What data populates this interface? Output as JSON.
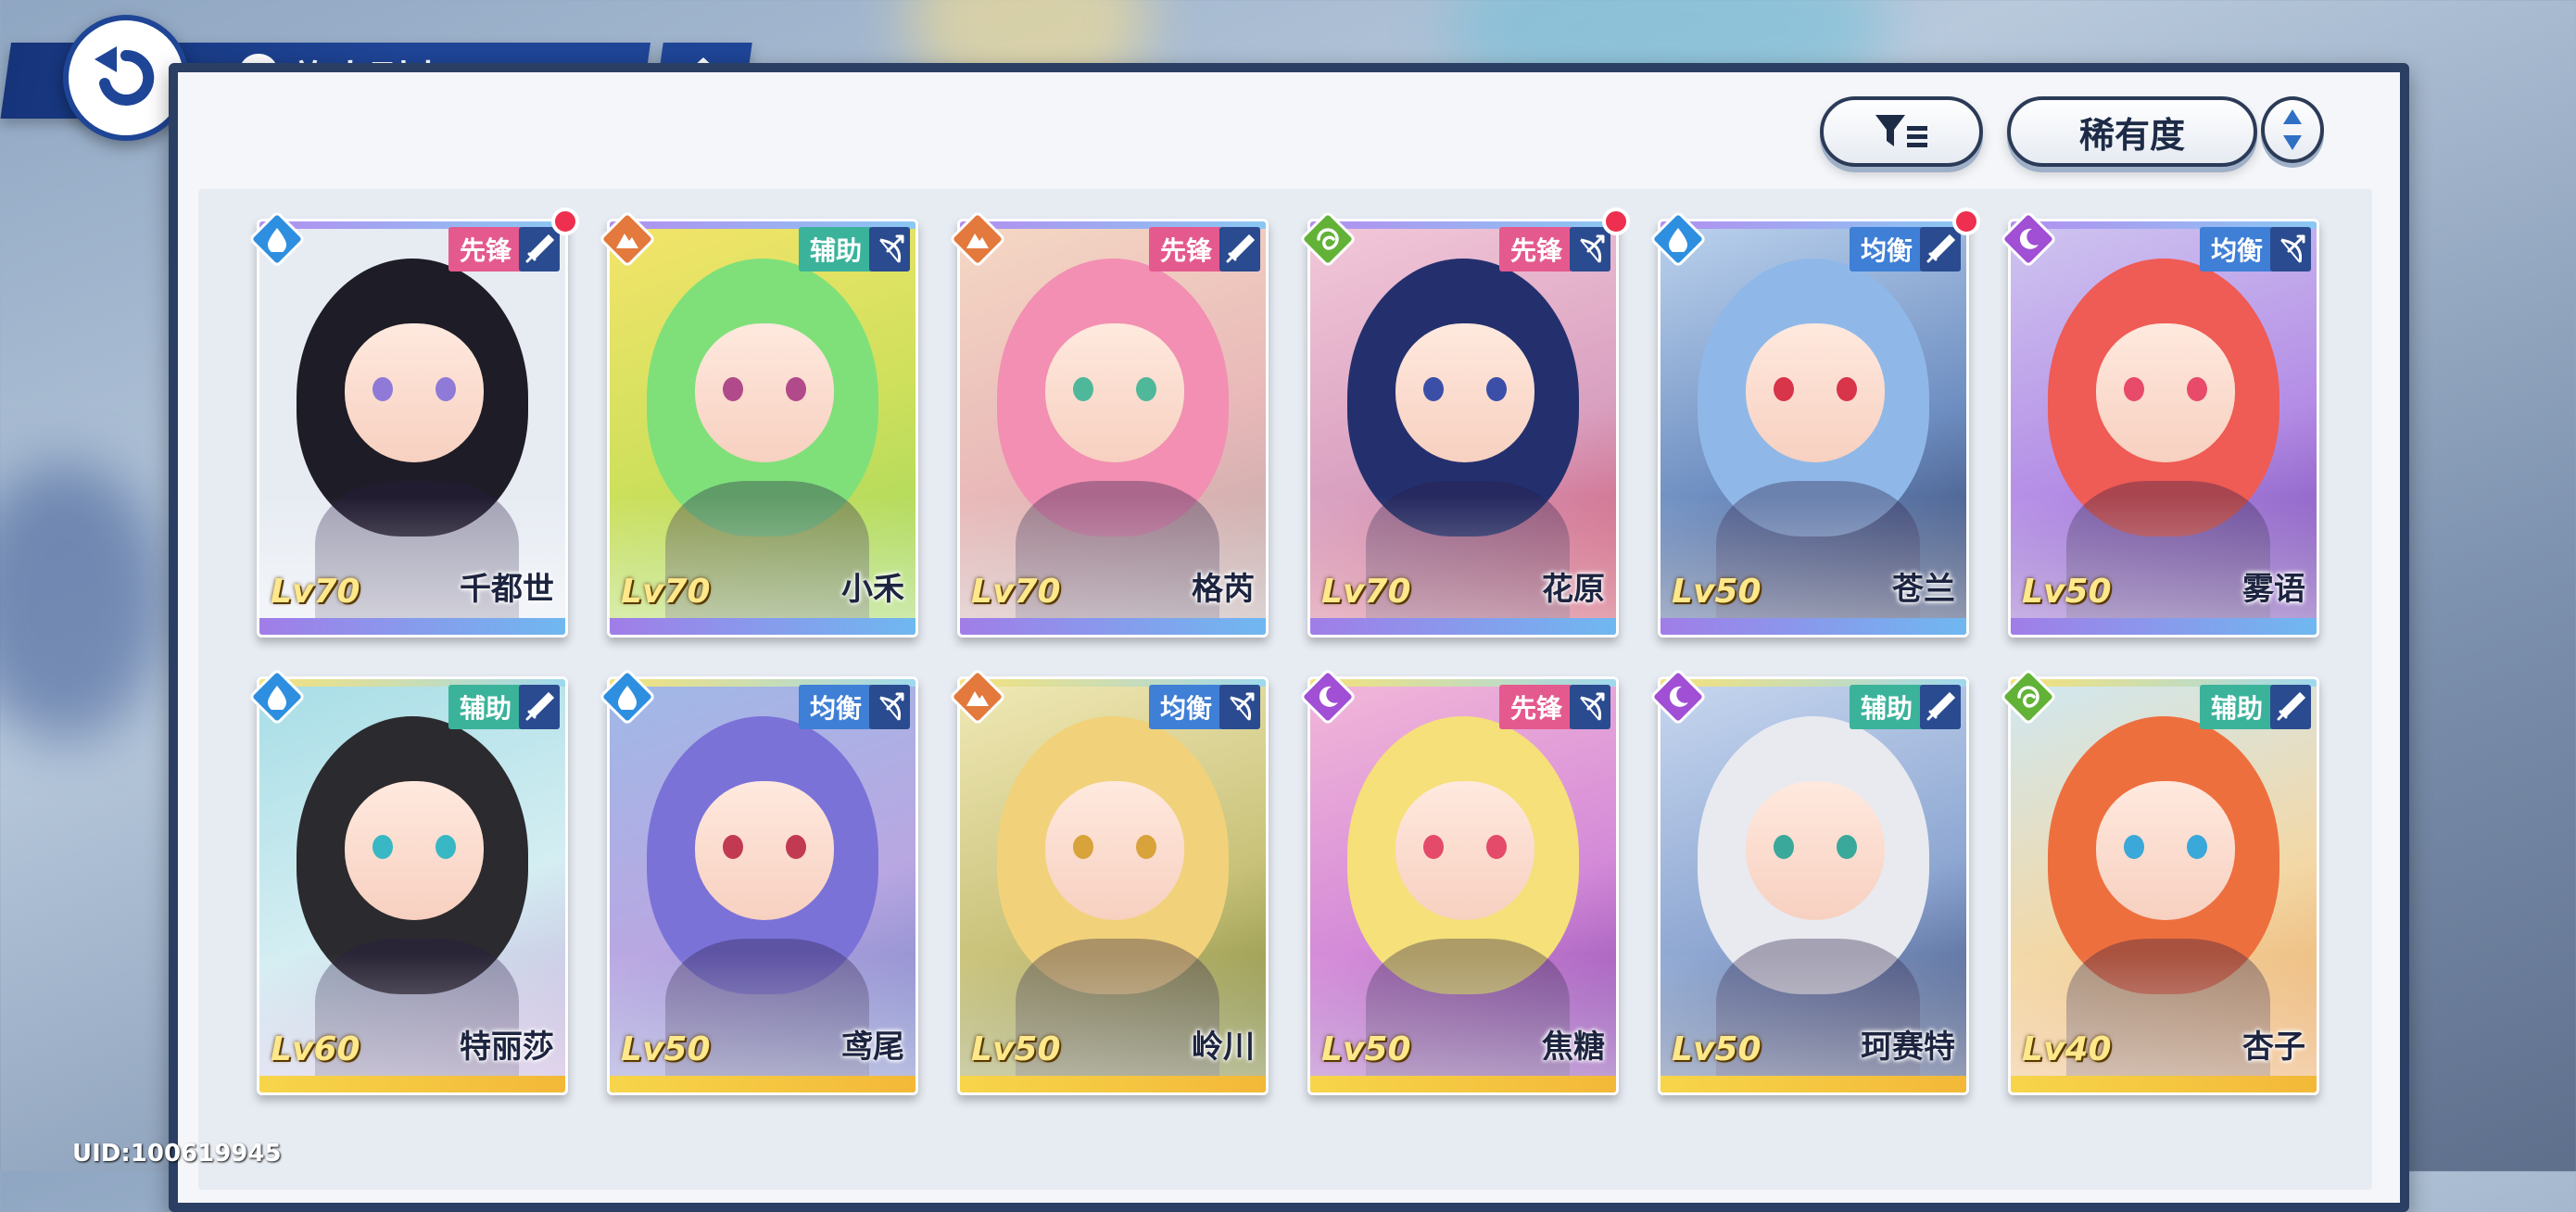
{
  "header": {
    "title": "旅人列表"
  },
  "toolbar": {
    "sort_label": "稀有度"
  },
  "uid": "UID:100619945",
  "colors": {
    "nav_blue": "#1f4597",
    "role_vanguard": "#e45a8e",
    "role_support": "#3bb39b",
    "role_balanced": "#3f7fd6",
    "new_dot": "#ef2f4f"
  },
  "cards": [
    {
      "name": "千都世",
      "level": "Lv70",
      "role": "先锋",
      "element": "water",
      "weapon": "sword",
      "new": true,
      "rarity": "purple"
    },
    {
      "name": "小禾",
      "level": "Lv70",
      "role": "辅助",
      "element": "earth",
      "weapon": "bow",
      "new": false,
      "rarity": "purple"
    },
    {
      "name": "格芮",
      "level": "Lv70",
      "role": "先锋",
      "element": "earth",
      "weapon": "sword",
      "new": false,
      "rarity": "purple"
    },
    {
      "name": "花原",
      "level": "Lv70",
      "role": "先锋",
      "element": "wind",
      "weapon": "bow",
      "new": true,
      "rarity": "purple"
    },
    {
      "name": "苍兰",
      "level": "Lv50",
      "role": "均衡",
      "element": "water",
      "weapon": "sword",
      "new": true,
      "rarity": "purple"
    },
    {
      "name": "雾语",
      "level": "Lv50",
      "role": "均衡",
      "element": "moon",
      "weapon": "bow",
      "new": false,
      "rarity": "purple"
    },
    {
      "name": "特丽莎",
      "level": "Lv60",
      "role": "辅助",
      "element": "water",
      "weapon": "sword",
      "new": false,
      "rarity": "gold"
    },
    {
      "name": "鸢尾",
      "level": "Lv50",
      "role": "均衡",
      "element": "water",
      "weapon": "bow",
      "new": false,
      "rarity": "gold"
    },
    {
      "name": "岭川",
      "level": "Lv50",
      "role": "均衡",
      "element": "earth",
      "weapon": "bow",
      "new": false,
      "rarity": "gold"
    },
    {
      "name": "焦糖",
      "level": "Lv50",
      "role": "先锋",
      "element": "moon",
      "weapon": "bow",
      "new": false,
      "rarity": "gold"
    },
    {
      "name": "珂赛特",
      "level": "Lv50",
      "role": "辅助",
      "element": "moon",
      "weapon": "sword",
      "new": false,
      "rarity": "gold"
    },
    {
      "name": "杏子",
      "level": "Lv40",
      "role": "辅助",
      "element": "wind",
      "weapon": "sword",
      "new": false,
      "rarity": "gold"
    }
  ]
}
